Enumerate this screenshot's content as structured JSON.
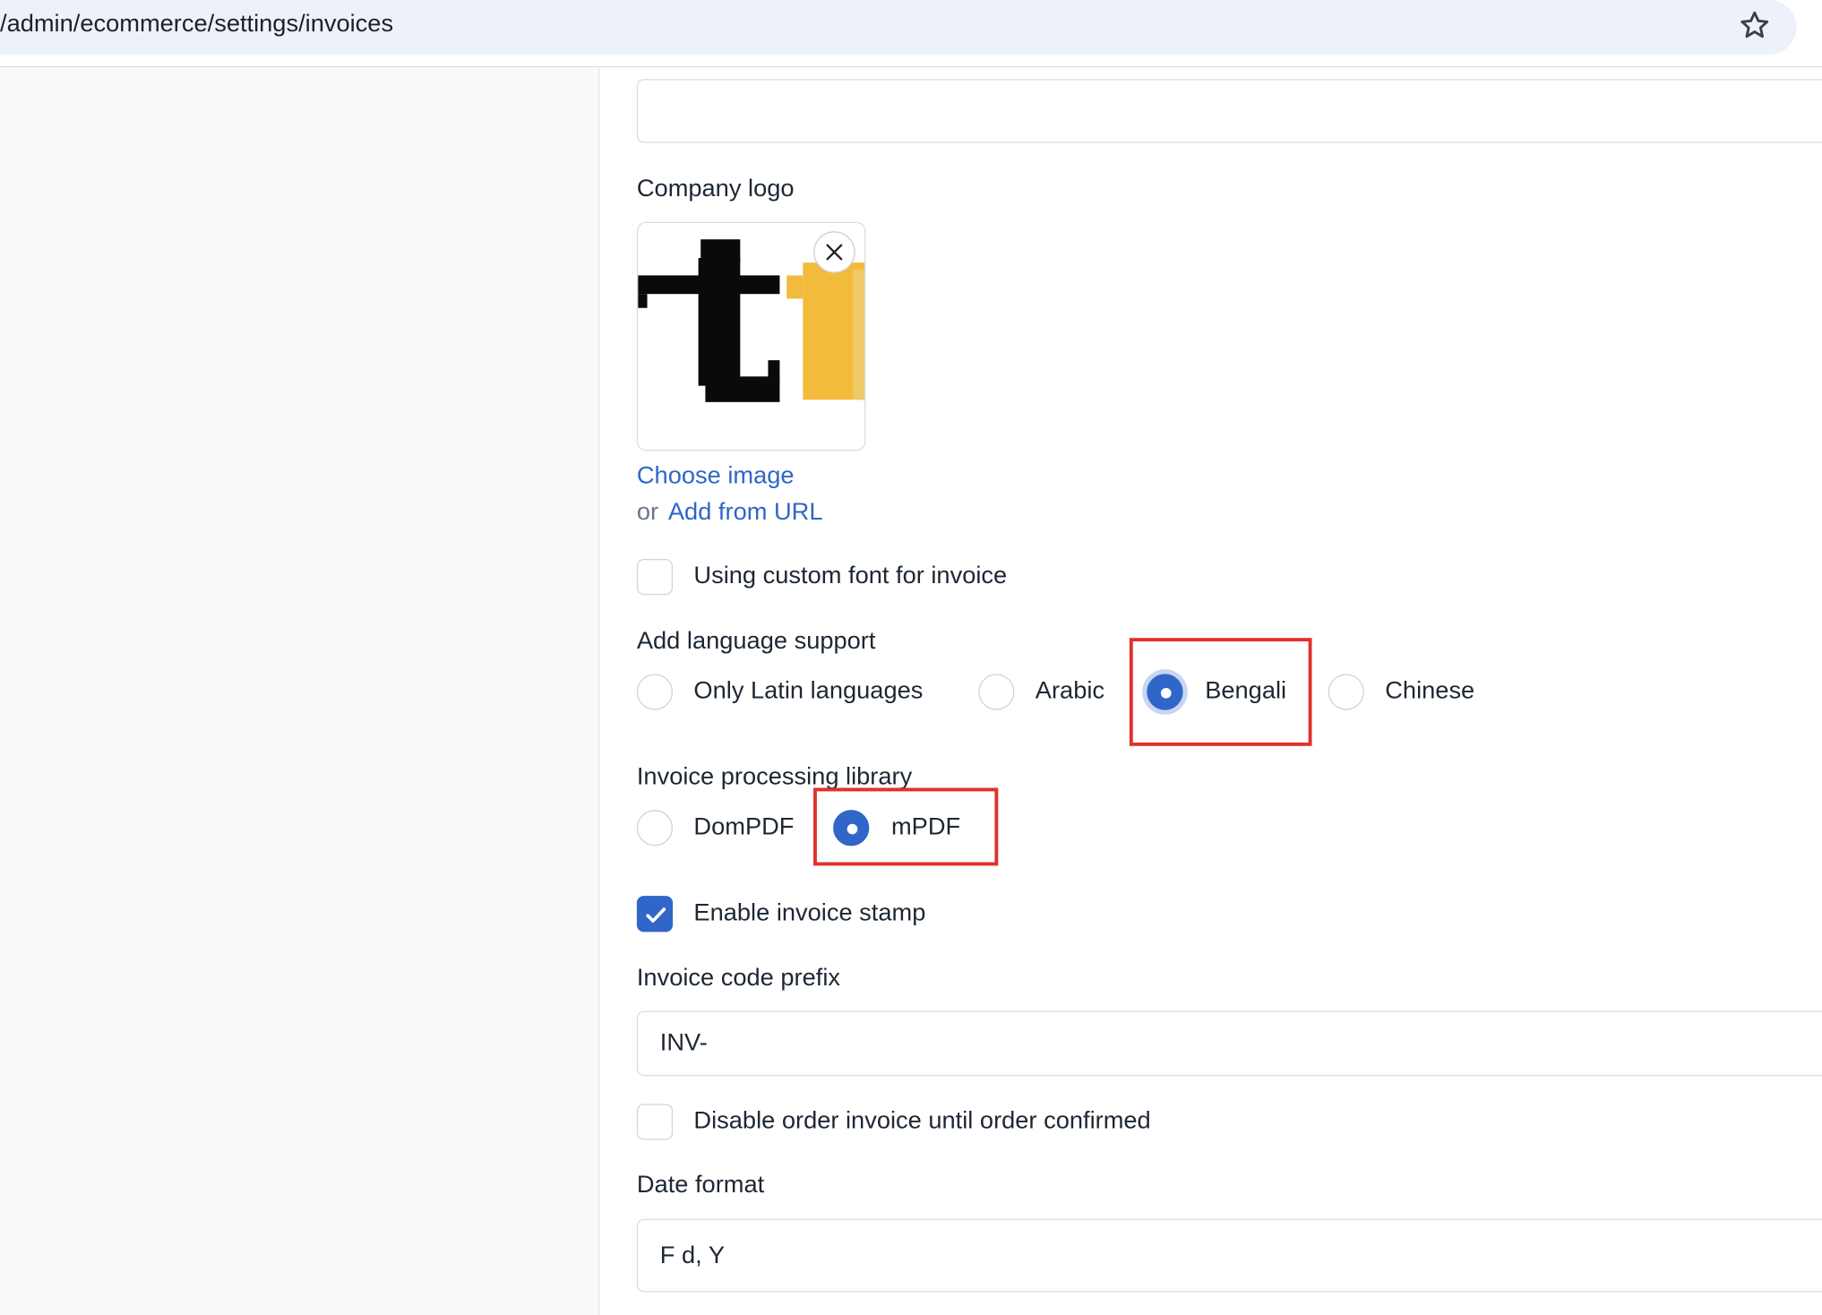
{
  "browser": {
    "url": "/admin/ecommerce/settings/invoices"
  },
  "form": {
    "company_logo_label": "Company logo",
    "choose_image_link": "Choose image",
    "or_text": "or",
    "add_from_url_link": "Add from URL",
    "custom_font_label": "Using custom font for invoice",
    "custom_font_checked": false,
    "language_support_label": "Add language support",
    "language_options": [
      {
        "label": "Only Latin languages",
        "selected": false
      },
      {
        "label": "Arabic",
        "selected": false
      },
      {
        "label": "Bengali",
        "selected": true
      },
      {
        "label": "Chinese",
        "selected": false
      }
    ],
    "processing_library_label": "Invoice processing library",
    "library_options": [
      {
        "label": "DomPDF",
        "selected": false
      },
      {
        "label": "mPDF",
        "selected": true
      }
    ],
    "invoice_stamp_label": "Enable invoice stamp",
    "invoice_stamp_checked": true,
    "code_prefix_label": "Invoice code prefix",
    "code_prefix_value": "INV-",
    "disable_invoice_label": "Disable order invoice until order confirmed",
    "disable_invoice_checked": false,
    "date_format_label": "Date format",
    "date_format_value": "F d, Y"
  },
  "colors": {
    "accent": "#2f66c8",
    "highlight": "#e0312b",
    "logo_yellow": "#f2bb3c"
  }
}
